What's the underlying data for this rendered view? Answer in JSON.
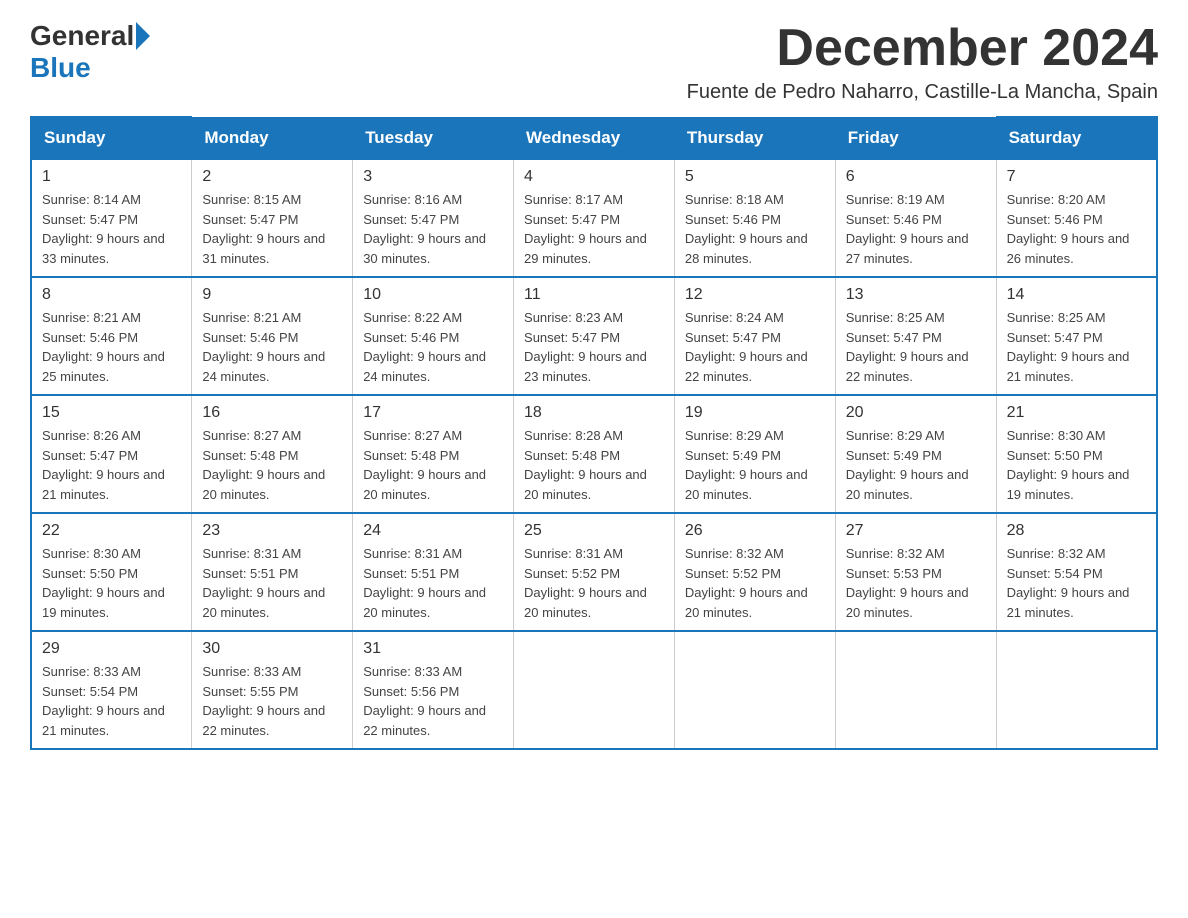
{
  "logo": {
    "general": "General",
    "blue": "Blue"
  },
  "title": {
    "month": "December 2024",
    "location": "Fuente de Pedro Naharro, Castille-La Mancha, Spain"
  },
  "weekdays": [
    "Sunday",
    "Monday",
    "Tuesday",
    "Wednesday",
    "Thursday",
    "Friday",
    "Saturday"
  ],
  "weeks": [
    [
      {
        "day": "1",
        "sunrise": "8:14 AM",
        "sunset": "5:47 PM",
        "daylight": "9 hours and 33 minutes."
      },
      {
        "day": "2",
        "sunrise": "8:15 AM",
        "sunset": "5:47 PM",
        "daylight": "9 hours and 31 minutes."
      },
      {
        "day": "3",
        "sunrise": "8:16 AM",
        "sunset": "5:47 PM",
        "daylight": "9 hours and 30 minutes."
      },
      {
        "day": "4",
        "sunrise": "8:17 AM",
        "sunset": "5:47 PM",
        "daylight": "9 hours and 29 minutes."
      },
      {
        "day": "5",
        "sunrise": "8:18 AM",
        "sunset": "5:46 PM",
        "daylight": "9 hours and 28 minutes."
      },
      {
        "day": "6",
        "sunrise": "8:19 AM",
        "sunset": "5:46 PM",
        "daylight": "9 hours and 27 minutes."
      },
      {
        "day": "7",
        "sunrise": "8:20 AM",
        "sunset": "5:46 PM",
        "daylight": "9 hours and 26 minutes."
      }
    ],
    [
      {
        "day": "8",
        "sunrise": "8:21 AM",
        "sunset": "5:46 PM",
        "daylight": "9 hours and 25 minutes."
      },
      {
        "day": "9",
        "sunrise": "8:21 AM",
        "sunset": "5:46 PM",
        "daylight": "9 hours and 24 minutes."
      },
      {
        "day": "10",
        "sunrise": "8:22 AM",
        "sunset": "5:46 PM",
        "daylight": "9 hours and 24 minutes."
      },
      {
        "day": "11",
        "sunrise": "8:23 AM",
        "sunset": "5:47 PM",
        "daylight": "9 hours and 23 minutes."
      },
      {
        "day": "12",
        "sunrise": "8:24 AM",
        "sunset": "5:47 PM",
        "daylight": "9 hours and 22 minutes."
      },
      {
        "day": "13",
        "sunrise": "8:25 AM",
        "sunset": "5:47 PM",
        "daylight": "9 hours and 22 minutes."
      },
      {
        "day": "14",
        "sunrise": "8:25 AM",
        "sunset": "5:47 PM",
        "daylight": "9 hours and 21 minutes."
      }
    ],
    [
      {
        "day": "15",
        "sunrise": "8:26 AM",
        "sunset": "5:47 PM",
        "daylight": "9 hours and 21 minutes."
      },
      {
        "day": "16",
        "sunrise": "8:27 AM",
        "sunset": "5:48 PM",
        "daylight": "9 hours and 20 minutes."
      },
      {
        "day": "17",
        "sunrise": "8:27 AM",
        "sunset": "5:48 PM",
        "daylight": "9 hours and 20 minutes."
      },
      {
        "day": "18",
        "sunrise": "8:28 AM",
        "sunset": "5:48 PM",
        "daylight": "9 hours and 20 minutes."
      },
      {
        "day": "19",
        "sunrise": "8:29 AM",
        "sunset": "5:49 PM",
        "daylight": "9 hours and 20 minutes."
      },
      {
        "day": "20",
        "sunrise": "8:29 AM",
        "sunset": "5:49 PM",
        "daylight": "9 hours and 20 minutes."
      },
      {
        "day": "21",
        "sunrise": "8:30 AM",
        "sunset": "5:50 PM",
        "daylight": "9 hours and 19 minutes."
      }
    ],
    [
      {
        "day": "22",
        "sunrise": "8:30 AM",
        "sunset": "5:50 PM",
        "daylight": "9 hours and 19 minutes."
      },
      {
        "day": "23",
        "sunrise": "8:31 AM",
        "sunset": "5:51 PM",
        "daylight": "9 hours and 20 minutes."
      },
      {
        "day": "24",
        "sunrise": "8:31 AM",
        "sunset": "5:51 PM",
        "daylight": "9 hours and 20 minutes."
      },
      {
        "day": "25",
        "sunrise": "8:31 AM",
        "sunset": "5:52 PM",
        "daylight": "9 hours and 20 minutes."
      },
      {
        "day": "26",
        "sunrise": "8:32 AM",
        "sunset": "5:52 PM",
        "daylight": "9 hours and 20 minutes."
      },
      {
        "day": "27",
        "sunrise": "8:32 AM",
        "sunset": "5:53 PM",
        "daylight": "9 hours and 20 minutes."
      },
      {
        "day": "28",
        "sunrise": "8:32 AM",
        "sunset": "5:54 PM",
        "daylight": "9 hours and 21 minutes."
      }
    ],
    [
      {
        "day": "29",
        "sunrise": "8:33 AM",
        "sunset": "5:54 PM",
        "daylight": "9 hours and 21 minutes."
      },
      {
        "day": "30",
        "sunrise": "8:33 AM",
        "sunset": "5:55 PM",
        "daylight": "9 hours and 22 minutes."
      },
      {
        "day": "31",
        "sunrise": "8:33 AM",
        "sunset": "5:56 PM",
        "daylight": "9 hours and 22 minutes."
      },
      null,
      null,
      null,
      null
    ]
  ]
}
